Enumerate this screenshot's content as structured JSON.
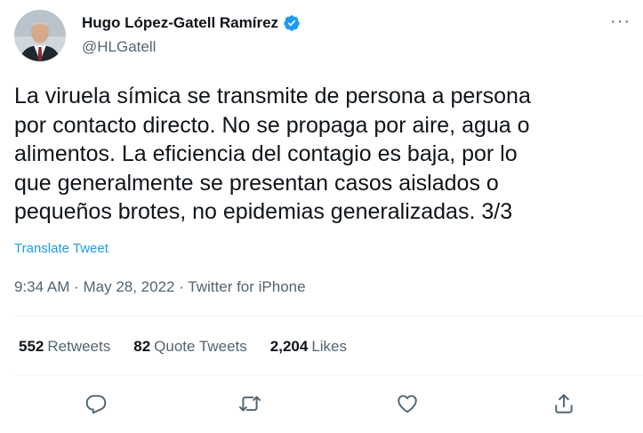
{
  "author": {
    "display_name": "Hugo López-Gatell Ramírez",
    "handle": "@HLGatell",
    "verified": true
  },
  "tweet": {
    "text": "La viruela símica se transmite de persona a persona\npor contacto directo. No se propaga por aire, agua o\nalimentos. La eficiencia del contagio es baja, por lo\nque generalmente se presentan casos aislados o\npequeños brotes, no epidemias generalizadas. 3/3",
    "translate_label": "Translate Tweet",
    "meta": "9:34 AM · May 28, 2022 · Twitter for iPhone"
  },
  "stats": {
    "retweets": {
      "count": "552",
      "label": "Retweets"
    },
    "quote_tweets": {
      "count": "82",
      "label": "Quote Tweets"
    },
    "likes": {
      "count": "2,204",
      "label": "Likes"
    }
  },
  "actions": [
    "reply-icon",
    "retweet-icon",
    "like-icon",
    "share-icon"
  ],
  "colors": {
    "accent": "#1d9bf0",
    "text_primary": "#0f1419",
    "text_secondary": "#536471",
    "divider": "#eff3f4"
  }
}
